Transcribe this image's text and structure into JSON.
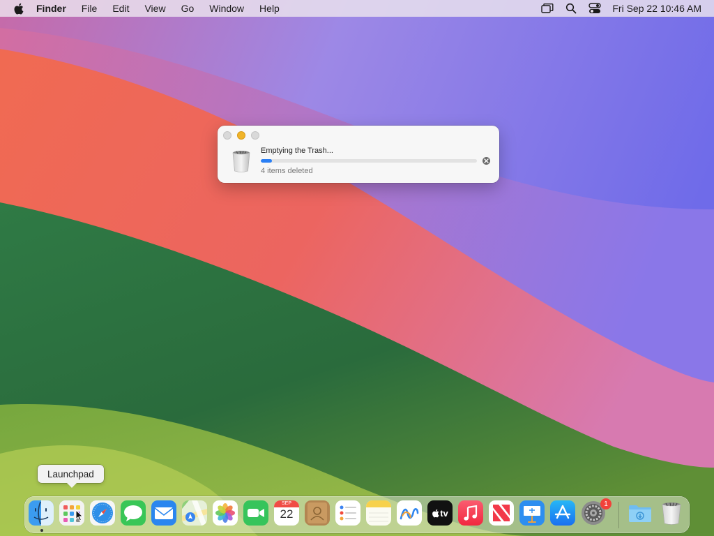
{
  "menubar": {
    "app_name": "Finder",
    "menus": [
      "File",
      "Edit",
      "View",
      "Go",
      "Window",
      "Help"
    ],
    "clock": "Fri Sep 22  10:46 AM",
    "status_icons": [
      "window-mirror-icon",
      "spotlight-search-icon",
      "control-center-icon"
    ]
  },
  "dialog": {
    "title": "Emptying the Trash...",
    "status": "4 items deleted",
    "progress_fraction": 0.05
  },
  "tooltip": {
    "label": "Launchpad"
  },
  "dock": {
    "items": [
      {
        "name": "Finder",
        "icon": "finder-icon"
      },
      {
        "name": "Launchpad",
        "icon": "launchpad-icon"
      },
      {
        "name": "Safari",
        "icon": "safari-icon"
      },
      {
        "name": "Messages",
        "icon": "messages-icon"
      },
      {
        "name": "Mail",
        "icon": "mail-icon"
      },
      {
        "name": "Maps",
        "icon": "maps-icon"
      },
      {
        "name": "Photos",
        "icon": "photos-icon"
      },
      {
        "name": "FaceTime",
        "icon": "facetime-icon"
      },
      {
        "name": "Calendar",
        "icon": "calendar-icon",
        "month": "SEP",
        "day": "22"
      },
      {
        "name": "Contacts",
        "icon": "contacts-icon"
      },
      {
        "name": "Reminders",
        "icon": "reminders-icon"
      },
      {
        "name": "Notes",
        "icon": "notes-icon"
      },
      {
        "name": "Freeform",
        "icon": "freeform-icon"
      },
      {
        "name": "TV",
        "icon": "apple-tv-icon",
        "label": "tv"
      },
      {
        "name": "Music",
        "icon": "music-icon"
      },
      {
        "name": "News",
        "icon": "news-icon"
      },
      {
        "name": "Keynote",
        "icon": "keynote-icon"
      },
      {
        "name": "App Store",
        "icon": "app-store-icon"
      },
      {
        "name": "System Settings",
        "icon": "system-settings-icon",
        "badge": "1"
      },
      {
        "name": "Downloads",
        "icon": "downloads-folder-icon"
      },
      {
        "name": "Trash",
        "icon": "trash-icon"
      }
    ]
  },
  "colors": {
    "accent": "#2a7ff5",
    "badge": "#f2413a",
    "minimize": "#f0b429"
  }
}
